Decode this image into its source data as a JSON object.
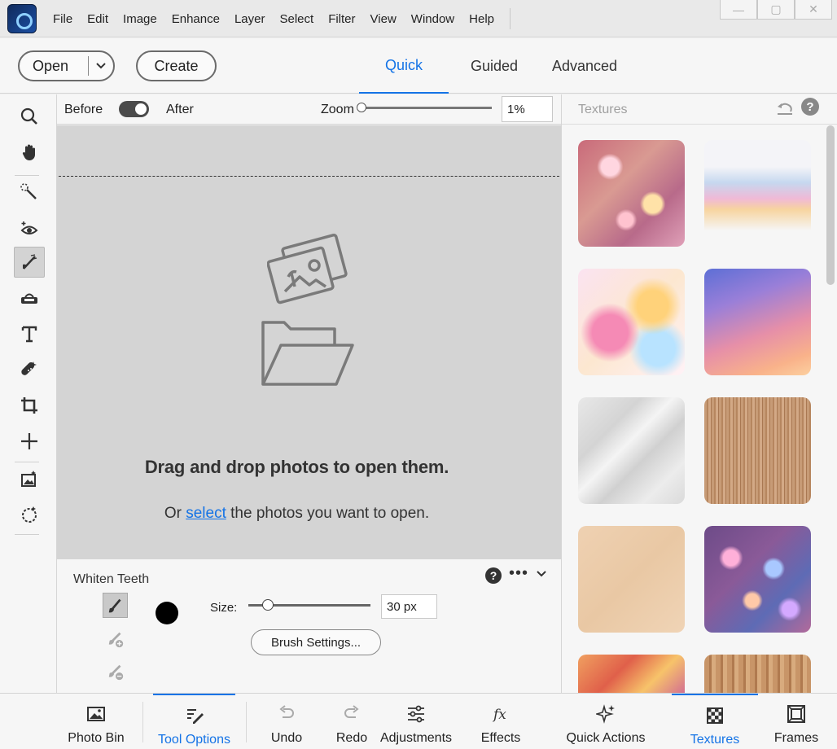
{
  "menu": {
    "items": [
      "File",
      "Edit",
      "Image",
      "Enhance",
      "Layer",
      "Select",
      "Filter",
      "View",
      "Window",
      "Help"
    ],
    "window_controls": [
      "—",
      "▢",
      "✕"
    ]
  },
  "mode_bar": {
    "open_label": "Open",
    "create_label": "Create",
    "tabs": [
      {
        "label": "Quick",
        "active": true
      },
      {
        "label": "Guided",
        "active": false
      },
      {
        "label": "Advanced",
        "active": false
      }
    ]
  },
  "view_bar": {
    "before_label": "Before",
    "after_label": "After",
    "zoom_label": "Zoom",
    "zoom_value": "1%"
  },
  "canvas": {
    "drop_title": "Drag and drop photos to open them.",
    "drop_prefix": "Or",
    "drop_link": "select",
    "drop_suffix": "the photos you want to open."
  },
  "tool_options": {
    "title": "Whiten Teeth",
    "help": "?",
    "more": "•••",
    "size_label": "Size:",
    "size_value": "30 px",
    "size_fraction": 0.16,
    "brush_settings_label": "Brush Settings..."
  },
  "textures_panel": {
    "title": "Textures",
    "help": "?"
  },
  "taskbar": {
    "photo_bin": "Photo Bin",
    "tool_options": "Tool Options",
    "undo": "Undo",
    "redo": "Redo",
    "adjustments": "Adjustments",
    "effects": "Effects",
    "quick_actions": "Quick Actions",
    "textures": "Textures",
    "frames": "Frames"
  },
  "colors": {
    "accent": "#1473e6",
    "canvas_bg": "#d4d4d4",
    "panel_bg": "#f6f6f6",
    "foreground_color": "#000000"
  },
  "icons": {
    "tools": [
      "zoom-icon",
      "hand-icon",
      "quick-selection-icon",
      "red-eye-icon",
      "whiten-teeth-icon",
      "straighten-icon",
      "type-icon",
      "spot-healing-icon",
      "crop-icon",
      "move-icon",
      "recompose-icon",
      "perfect-pet-icon"
    ]
  }
}
